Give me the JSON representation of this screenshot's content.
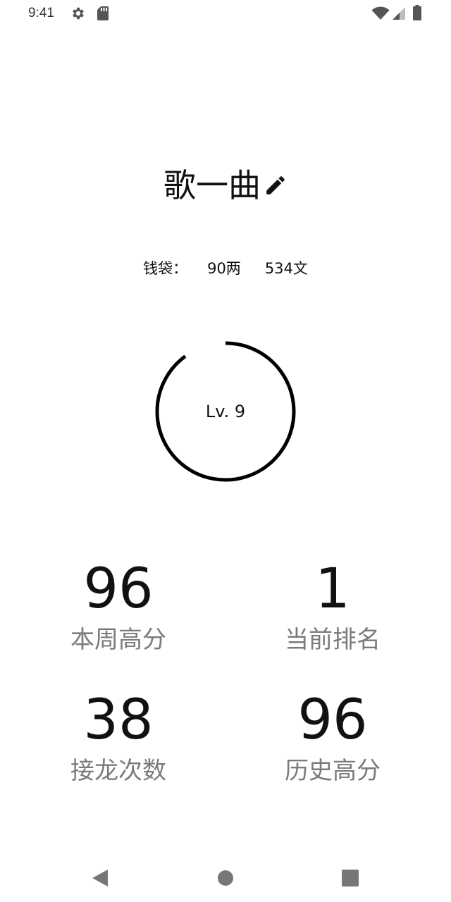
{
  "status_bar": {
    "time": "9:41",
    "icons_left": [
      "gear-icon",
      "sd-card-icon"
    ],
    "icons_right": [
      "wifi-icon",
      "signal-icon",
      "battery-icon"
    ]
  },
  "profile": {
    "name": "歌一曲",
    "edit_icon": "pencil-icon"
  },
  "wallet": {
    "label": "钱袋：",
    "liang": "90两",
    "wen": "534文"
  },
  "level": {
    "label": "Lv. 9",
    "progress_fraction": 0.9
  },
  "stats": [
    {
      "value": "96",
      "label": "本周高分"
    },
    {
      "value": "1",
      "label": "当前排名"
    },
    {
      "value": "38",
      "label": "接龙次数"
    },
    {
      "value": "96",
      "label": "历史高分"
    }
  ],
  "nav": {
    "back": "back-triangle-icon",
    "home": "home-circle-icon",
    "recents": "recents-square-icon"
  },
  "colors": {
    "text": "#111111",
    "secondary_text": "#7b7b7b",
    "status_icons": "#555555",
    "nav_icons": "#777777"
  }
}
